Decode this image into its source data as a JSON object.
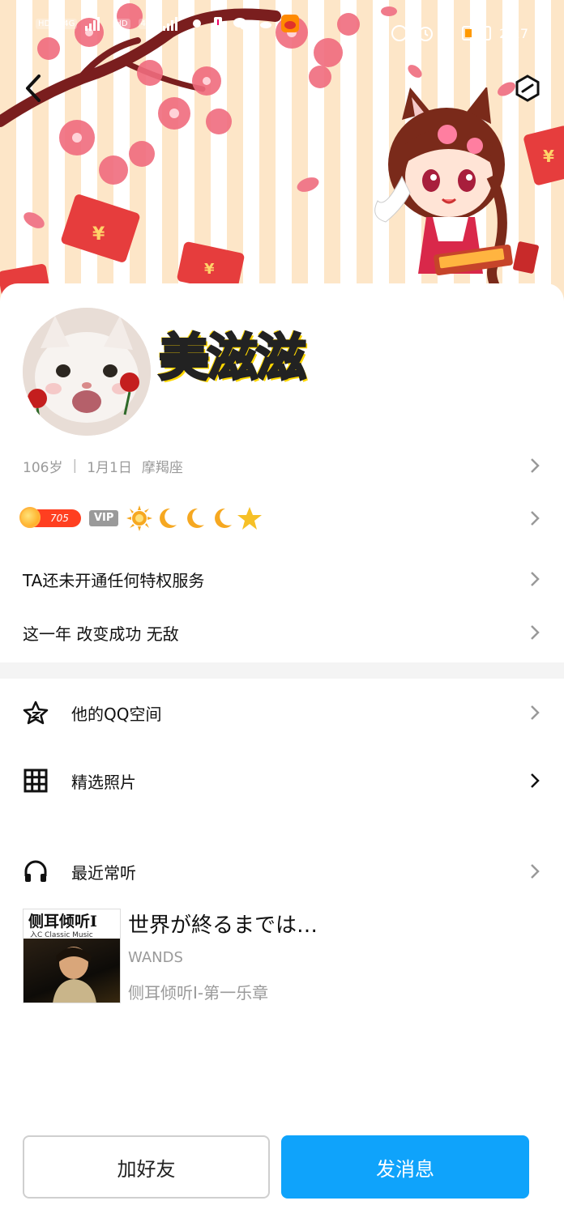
{
  "status_bar": {
    "sim1": "HD",
    "sim2": "HD",
    "network1": "4G",
    "network2": "4G",
    "more": "···",
    "battery": "16",
    "time": "2:27"
  },
  "banner": {
    "decor_text": "",
    "colors": {
      "stripe": "#fde6c8",
      "blossom": "#f06c7e",
      "envelope": "#e63d3d"
    }
  },
  "profile": {
    "nickname": "美滋滋",
    "age": "106岁",
    "birthday": "1月1日",
    "zodiac": "摩羯座",
    "level": "705",
    "vip_label": "VIP",
    "privilege_text": "TA还未开通任何特权服务",
    "signature": "这一年 改变成功 无敌"
  },
  "menu": {
    "qzone_label": "他的QQ空间",
    "photos_label": "精选照片",
    "recent_label": "最近常听"
  },
  "song": {
    "title": "世界が終るまでは…",
    "artist": "WANDS",
    "album": "侧耳倾听I-第一乐章",
    "cover_title": "侧耳倾听I",
    "cover_subtitle": "入C Classic Music"
  },
  "actions": {
    "add_friend": "加好友",
    "send_message": "发消息"
  },
  "colors": {
    "primary_button": "#0fa3fb",
    "level_badge": "#ff3f20",
    "muted_text": "#9a9a9a"
  }
}
